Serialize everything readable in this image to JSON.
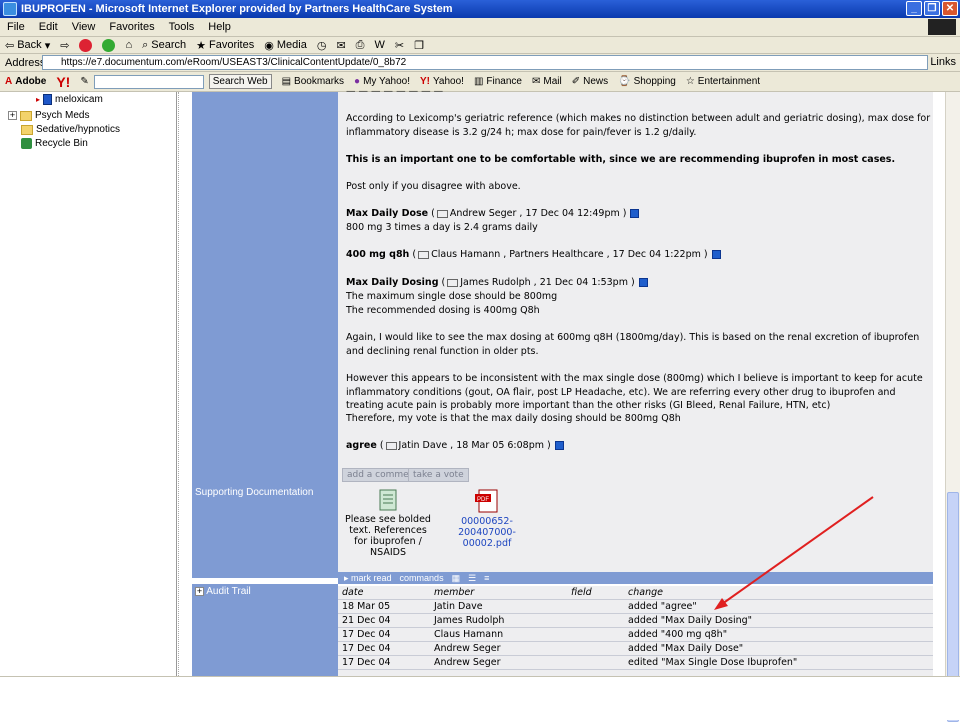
{
  "window": {
    "title": "IBUPROFEN - Microsoft Internet Explorer provided by Partners HealthCare System",
    "minimize": "_",
    "maximize": "❐",
    "close": "✕"
  },
  "menu": [
    "File",
    "Edit",
    "View",
    "Favorites",
    "Tools",
    "Help"
  ],
  "toolbar": {
    "back": "Back",
    "search": "Search",
    "favorites": "Favorites",
    "media": "Media"
  },
  "address": {
    "label": "Address",
    "url": "https://e7.documentum.com/eRoom/USEAST3/ClinicalContentUpdate/0_8b72",
    "links": "Links"
  },
  "yahoo": {
    "adobe": "Adobe",
    "search_web": "Search Web",
    "bookmarks": "Bookmarks",
    "my_yahoo": "My Yahoo!",
    "yahoo": "Yahoo!",
    "finance": "Finance",
    "mail": "Mail",
    "news": "News",
    "shopping": "Shopping",
    "entertainment": "Entertainment"
  },
  "sidebar": {
    "items": [
      {
        "label": "meloxicam"
      },
      {
        "label": "Psych Meds"
      },
      {
        "label": "Sedative/hypnotics"
      },
      {
        "label": "Recycle Bin"
      }
    ]
  },
  "content": {
    "p1": "According to Lexicomp's geriatric reference (which makes no distinction between adult and geriatric dosing), max dose for inflammatory disease is 3.2 g/24 h; max dose for pain/fever is 1.2 g/daily.",
    "p2": "This is an important one to be comfortable with, since we are recommending ibuprofen in most cases.",
    "p3": "Post only if you disagree with above.",
    "c1_title": "Max Daily Dose",
    "c1_meta": "Andrew Seger , 17 Dec 04  12:49pm )",
    "c1_body": "800 mg 3 times a day is 2.4 grams daily",
    "c2_title": "400 mg q8h",
    "c2_meta": "Claus Hamann , Partners Healthcare , 17 Dec 04  1:22pm )",
    "c3_title": "Max Daily Dosing",
    "c3_meta": "James Rudolph , 21 Dec 04  1:53pm )",
    "c3_line1": "The maximum single dose should be 800mg",
    "c3_line2": "The recommended dosing is 400mg Q8h",
    "c3_para1": "Again, I would like to see the max dosing at 600mg q8H (1800mg/day).  This is based on the renal excretion of ibuprofen and declining renal function in older pts.",
    "c3_para2": "However this appears to be inconsistent with the max single dose (800mg) which I believe is important to keep for acute inflammatory conditions (gout, OA flair, post LP Headache, etc).  We are referring every other drug to ibuprofen and treating acute pain is probably more important than the other risks (GI Bleed, Renal Failure, HTN, etc)",
    "c3_para3": "Therefore, my vote is that the max daily dosing should be 800mg Q8h",
    "c4_title": "agree",
    "c4_meta": "Jatin Dave , 18 Mar 05  6:08pm )",
    "add_comment": "add a comment",
    "take_vote": "take a vote"
  },
  "supporting": {
    "label": "Supporting Documentation",
    "att1": "Please see bolded text. References for ibuprofen / NSAIDS",
    "att2": "00000652-200407000-00002.pdf",
    "mark_read": "mark read",
    "commands": "commands"
  },
  "audit": {
    "label": "Audit Trail",
    "headers": {
      "date": "date",
      "member": "member",
      "field": "field",
      "change": "change"
    },
    "rows": [
      {
        "date": "18 Mar 05",
        "member": "Jatin Dave",
        "field": "",
        "change": "added \"agree\""
      },
      {
        "date": "21 Dec 04",
        "member": "James Rudolph",
        "field": "",
        "change": "added \"Max Daily Dosing\""
      },
      {
        "date": "17 Dec 04",
        "member": "Claus Hamann",
        "field": "",
        "change": "added \"400 mg q8h\""
      },
      {
        "date": "17 Dec 04",
        "member": "Andrew Seger",
        "field": "",
        "change": "added \"Max Daily Dose\""
      },
      {
        "date": "17 Dec 04",
        "member": "Andrew Seger",
        "field": "",
        "change": "edited \"Max Single Dose Ibuprofen\""
      }
    ]
  },
  "colors": {
    "panel_blue": "#7f9bd3",
    "annotation_arrow": "#e02020"
  }
}
